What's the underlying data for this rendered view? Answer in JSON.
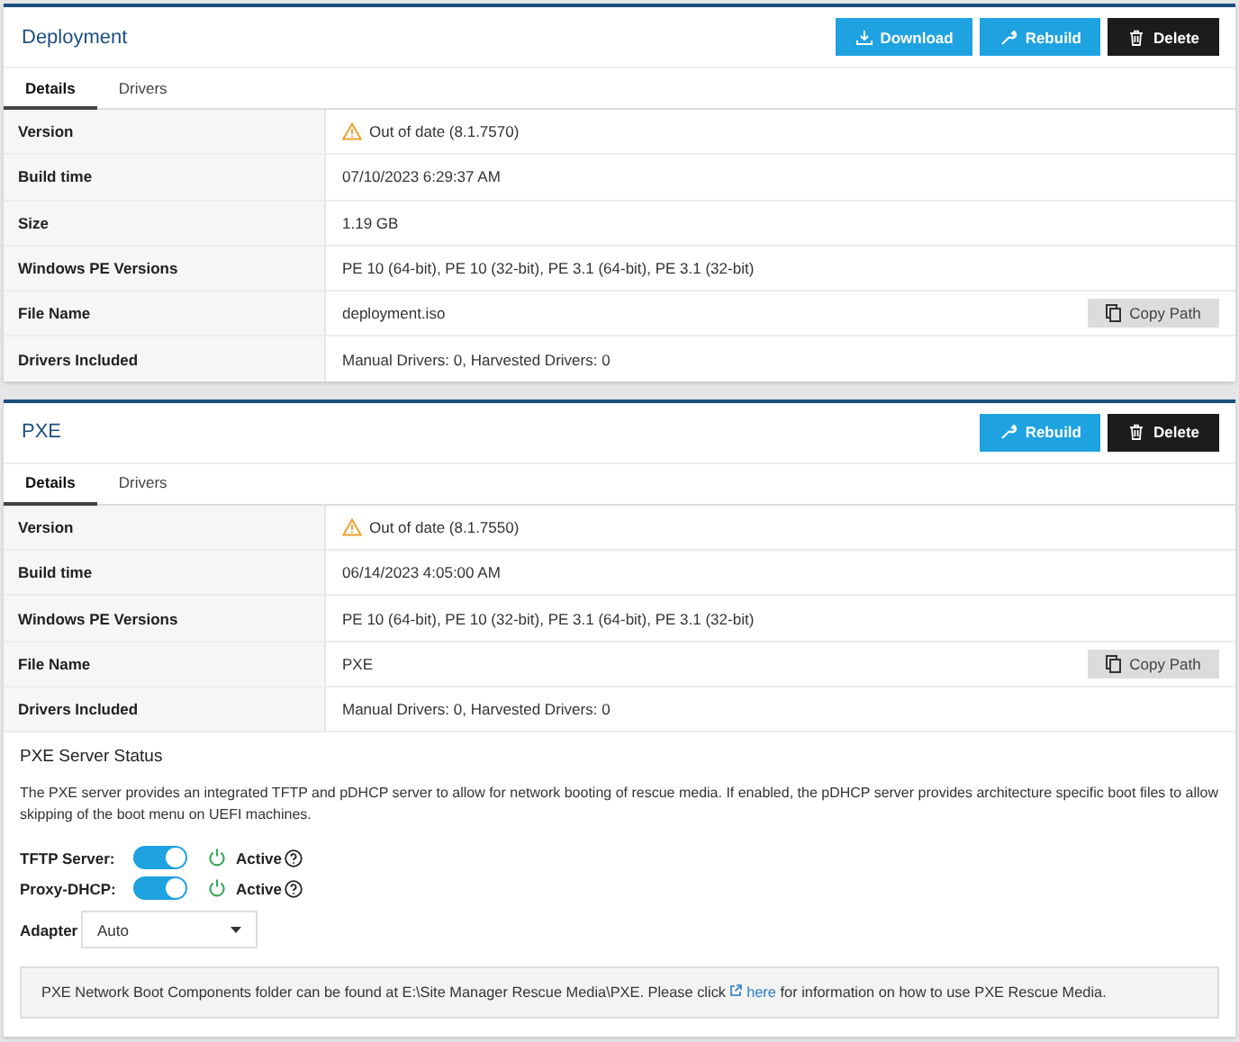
{
  "panels": [
    {
      "title": "Deployment",
      "buttons": [
        {
          "label": "Download",
          "kind": "download"
        },
        {
          "label": "Rebuild",
          "kind": "rebuild"
        },
        {
          "label": "Delete",
          "kind": "delete"
        }
      ],
      "tabs": [
        {
          "label": "Details",
          "selected": true
        },
        {
          "label": "Drivers",
          "selected": false
        }
      ],
      "rows": [
        {
          "label": "Version",
          "value": "Out of date (8.1.7570)",
          "warning": true
        },
        {
          "label": "Build time",
          "value": "07/10/2023 6:29:37 AM",
          "warning": false
        },
        {
          "label": "Size",
          "value": "1.19 GB",
          "warning": false
        },
        {
          "label": "Windows PE Versions",
          "value": "PE 10 (64-bit), PE 10 (32-bit), PE 3.1 (64-bit), PE 3.1 (32-bit)",
          "warning": false
        },
        {
          "label": "File Name",
          "value": "deployment.iso",
          "warning": false,
          "action": "Copy Path"
        },
        {
          "label": "Drivers Included",
          "value": "Manual Drivers: 0, Harvested Drivers: 0",
          "warning": false
        }
      ]
    },
    {
      "title": "PXE",
      "buttons": [
        {
          "label": "Rebuild",
          "kind": "rebuild"
        },
        {
          "label": "Delete",
          "kind": "delete"
        }
      ],
      "tabs": [
        {
          "label": "Details",
          "selected": true
        },
        {
          "label": "Drivers",
          "selected": false
        }
      ],
      "rows": [
        {
          "label": "Version",
          "value": "Out of date (8.1.7550)",
          "warning": true
        },
        {
          "label": "Build time",
          "value": "06/14/2023 4:05:00 AM",
          "warning": false
        },
        {
          "label": "Windows PE Versions",
          "value": "PE 10 (64-bit), PE 10 (32-bit), PE 3.1 (64-bit), PE 3.1 (32-bit)",
          "warning": false
        },
        {
          "label": "File Name",
          "value": "PXE",
          "warning": false,
          "action": "Copy Path"
        },
        {
          "label": "Drivers Included",
          "value": "Manual Drivers: 0, Harvested Drivers: 0",
          "warning": false
        }
      ],
      "server_status": {
        "heading": "PXE Server Status",
        "description": "The PXE server provides an integrated TFTP and pDHCP server to allow for network booting of rescue media. If enabled, the pDHCP server provides architecture specific boot files to allow skipping of the boot menu on UEFI machines.",
        "switches": [
          {
            "label": "TFTP Server:",
            "on": true,
            "status": "Active"
          },
          {
            "label": "Proxy-DHCP:",
            "on": true,
            "status": "Active"
          }
        ],
        "adapter": {
          "label": "Adapter",
          "value": "Auto"
        },
        "note": {
          "before": "PXE Network Boot Components folder can be found at E:\\Site Manager Rescue Media\\PXE. Please click ",
          "link": "here",
          "after": " for information on how to use PXE Rescue Media."
        }
      }
    }
  ]
}
